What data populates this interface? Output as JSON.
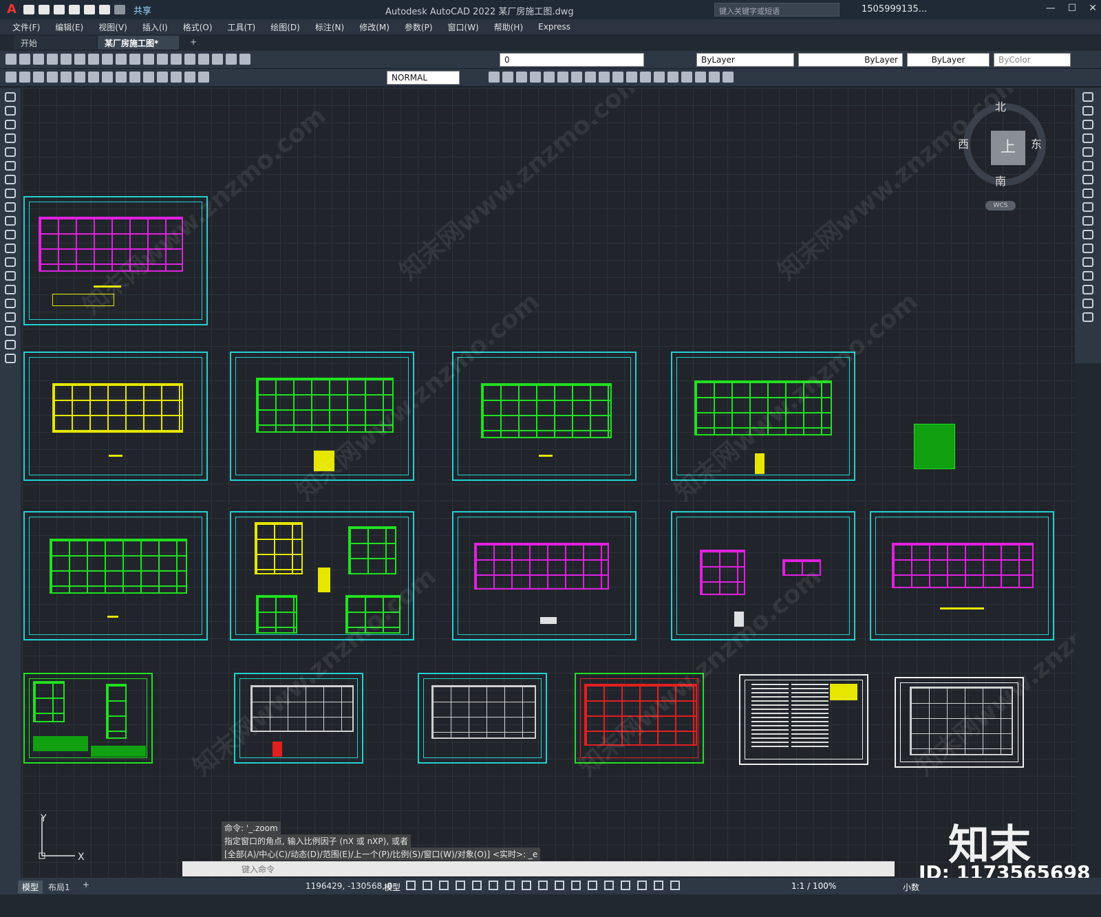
{
  "titlebar": {
    "app_logo": "A",
    "share_label": "共享",
    "title": "Autodesk AutoCAD 2022    某厂房施工图.dwg",
    "search_placeholder": "键入关键字或短语",
    "user": "1505999135...",
    "window_buttons": [
      "—",
      "☐",
      "✕"
    ]
  },
  "menu": [
    "文件(F)",
    "编辑(E)",
    "视图(V)",
    "插入(I)",
    "格式(O)",
    "工具(T)",
    "绘图(D)",
    "标注(N)",
    "修改(M)",
    "参数(P)",
    "窗口(W)",
    "帮助(H)",
    "Express"
  ],
  "tabs": {
    "start": "开始",
    "drawing": "某厂房施工图*",
    "add": "+"
  },
  "toolbar": {
    "layer": "0",
    "color": "ByLayer",
    "linetype": "ByLayer",
    "lineweight": "ByLayer",
    "plotstyle": "ByColor",
    "dimstyle": "NORMAL"
  },
  "viewcube": {
    "north": "北",
    "south": "南",
    "east": "东",
    "west": "西",
    "face": "上",
    "wcs": "WCS"
  },
  "command": {
    "history": [
      "命令: '_.zoom",
      "指定窗口的角点, 输入比例因子 (nX 或 nXP), 或者",
      "[全部(A)/中心(C)/动态(D)/范围(E)/上一个(P)/比例(S)/窗口(W)/对象(O)] <实时>: _e"
    ],
    "placeholder": "键入命令"
  },
  "status": {
    "model_tab": "模型",
    "layout_tab": "布局1",
    "add_tab": "+",
    "coords": "1196429, -130568, 0",
    "space": "模型",
    "scale": "1:1 / 100%",
    "units": "小数"
  },
  "overlay": {
    "brand": "知末",
    "id": "ID: 1173565698",
    "watermark": "知末网www.znzmo.com"
  },
  "ucs": {
    "y": "Y",
    "x": "X"
  }
}
